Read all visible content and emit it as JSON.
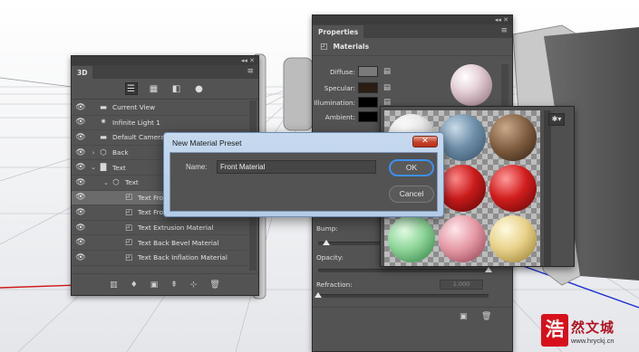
{
  "panel3d": {
    "tab_title": "3D",
    "topbar_glyphs": "◂◂  ✕",
    "menu_icon": "≡",
    "toolbar": [
      "scene-filter-icon",
      "mesh-filter-icon",
      "material-filter-icon",
      "light-filter-icon"
    ],
    "layers": [
      {
        "name": "Current View",
        "icon": "camera-icon",
        "eye": true,
        "indent": 0,
        "twirl": ""
      },
      {
        "name": "Infinite Light 1",
        "icon": "light-icon",
        "eye": true,
        "indent": 0,
        "twirl": ""
      },
      {
        "name": "Default Camera",
        "icon": "camera-icon",
        "eye": true,
        "indent": 0,
        "twirl": ""
      },
      {
        "name": "Back",
        "icon": "mesh-icon",
        "eye": true,
        "indent": 0,
        "twirl": "›"
      },
      {
        "name": "Text",
        "icon": "folder-icon",
        "eye": true,
        "indent": 0,
        "twirl": "⌄"
      },
      {
        "name": "Text",
        "icon": "mesh-icon",
        "eye": true,
        "indent": 1,
        "twirl": "⌄"
      },
      {
        "name": "Text Front Inflation Material",
        "icon": "material-icon",
        "eye": true,
        "indent": 2,
        "twirl": "",
        "selected": true
      },
      {
        "name": "Text Front Bevel Material",
        "icon": "material-icon",
        "eye": true,
        "indent": 2,
        "twirl": ""
      },
      {
        "name": "Text Extrusion Material",
        "icon": "material-icon",
        "eye": true,
        "indent": 2,
        "twirl": ""
      },
      {
        "name": "Text Back Bevel Material",
        "icon": "material-icon",
        "eye": true,
        "indent": 2,
        "twirl": ""
      },
      {
        "name": "Text Back Inflation Material",
        "icon": "material-icon",
        "eye": true,
        "indent": 2,
        "twirl": ""
      }
    ],
    "bottom_icons": [
      "render-icon",
      "add-light-icon",
      "new-material-icon",
      "export-icon",
      "coordinates-icon",
      "trash-icon"
    ]
  },
  "properties": {
    "tab_title": "Properties",
    "topbar_glyphs": "◂◂  ✕",
    "menu_icon": "≡",
    "section_title": "Materials",
    "rows": [
      {
        "label": "Diffuse:",
        "color": "#7a7a7a"
      },
      {
        "label": "Specular:",
        "color": "#2a1e14"
      },
      {
        "label": "Illumination:",
        "color": "#000000"
      },
      {
        "label": "Ambient:",
        "color": "#000000"
      }
    ],
    "bump_label": "Bump:",
    "opacity_label": "Opacity:",
    "refraction_label": "Refraction:",
    "refraction_value": "1.000",
    "bump_level": 0.05,
    "opacity_level": 1.0,
    "refraction_level": 0.0
  },
  "picker": {
    "gear_glyph": "✱▾",
    "materials": [
      {
        "name": "glossy-white"
      },
      {
        "name": "blue-paint"
      },
      {
        "name": "wood"
      },
      {
        "name": "sparkle-gold"
      },
      {
        "name": "red-sparkle"
      },
      {
        "name": "red-sparkle-2"
      },
      {
        "name": "green-glass"
      },
      {
        "name": "pink-glass"
      },
      {
        "name": "gold-glass"
      }
    ]
  },
  "dialog": {
    "title": "New Material Preset",
    "close_glyph": "✕",
    "name_label": "Name:",
    "name_value": "Front Material",
    "ok_label": "OK",
    "cancel_label": "Cancel"
  },
  "watermark": {
    "stamp": "浩",
    "name": "然文城",
    "url": "www.hryckj.cn"
  }
}
